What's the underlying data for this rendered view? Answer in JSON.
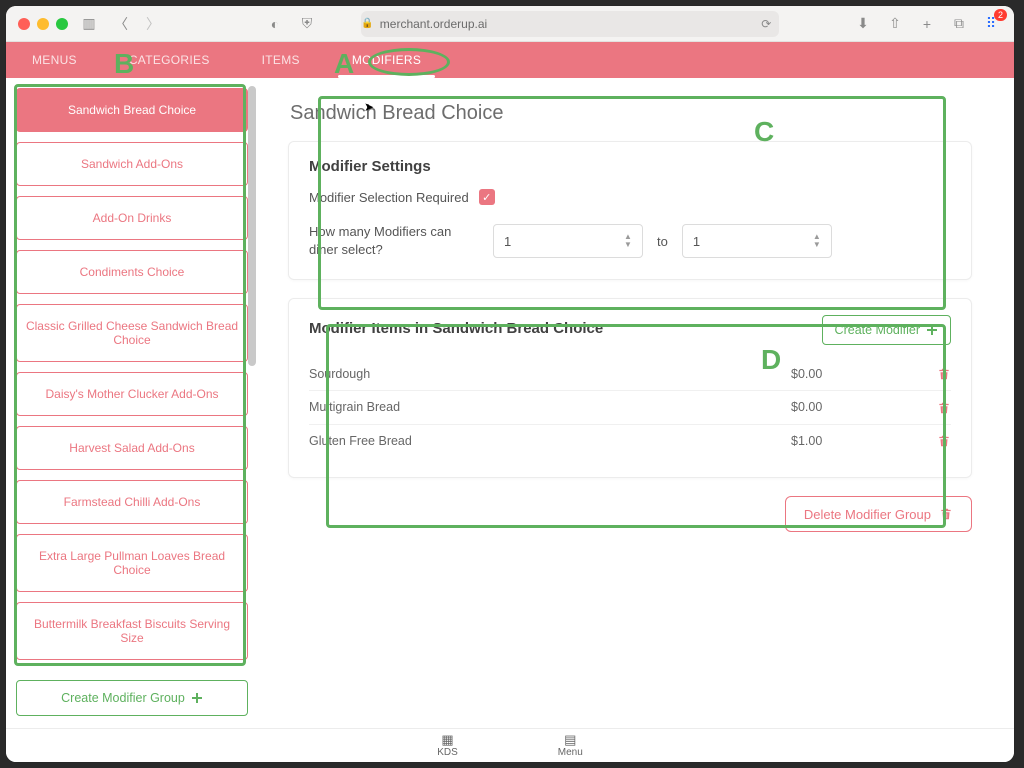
{
  "browser": {
    "url": "merchant.orderup.ai",
    "badge_count": "2"
  },
  "tabs": [
    {
      "label": "MENUS"
    },
    {
      "label": "CATEGORIES"
    },
    {
      "label": "ITEMS"
    },
    {
      "label": "MODIFIERS"
    }
  ],
  "sidebar": {
    "items": [
      {
        "label": "Sandwich Bread Choice"
      },
      {
        "label": "Sandwich Add-Ons"
      },
      {
        "label": "Add-On Drinks"
      },
      {
        "label": "Condiments Choice"
      },
      {
        "label": "Classic Grilled Cheese Sandwich Bread Choice"
      },
      {
        "label": "Daisy's Mother Clucker Add-Ons"
      },
      {
        "label": "Harvest Salad Add-Ons"
      },
      {
        "label": "Farmstead Chilli Add-Ons"
      },
      {
        "label": "Extra Large Pullman Loaves Bread Choice"
      },
      {
        "label": "Buttermilk Breakfast Biscuits Serving Size"
      }
    ],
    "create_group_label": "Create Modifier Group"
  },
  "panel": {
    "title": "Sandwich Bread Choice",
    "settings_title": "Modifier Settings",
    "required_label": "Modifier Selection Required",
    "required_checked": true,
    "range_label": "How many Modifiers can diner select?",
    "range_min": "1",
    "range_to": "to",
    "range_max": "1",
    "items_title": "Modifier Items in Sandwich Bread Choice",
    "create_modifier_label": "Create Modifier",
    "delete_group_label": "Delete Modifier Group",
    "modifier_items": [
      {
        "name": "Sourdough",
        "price": "$0.00"
      },
      {
        "name": "Multigrain Bread",
        "price": "$0.00"
      },
      {
        "name": "Gluten Free Bread",
        "price": "$1.00"
      }
    ]
  },
  "bottom": {
    "kds": "KDS",
    "menu": "Menu"
  },
  "annotations": {
    "A": "A",
    "B": "B",
    "C": "C",
    "D": "D"
  }
}
